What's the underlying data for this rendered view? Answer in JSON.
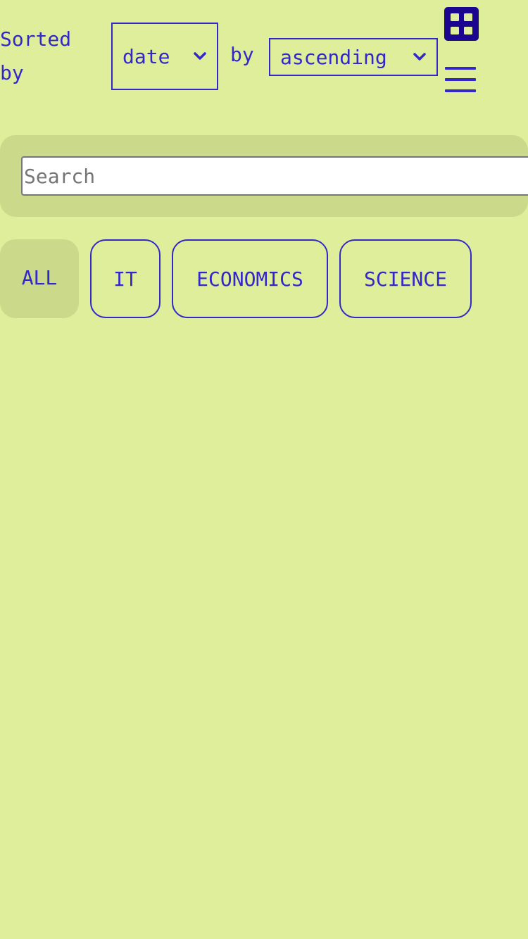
{
  "sort": {
    "prefix_label": "Sorted by",
    "field_selected": "date",
    "by_label": "by",
    "order_selected": "ascending"
  },
  "icons": {
    "grid": "grid-view-icon",
    "menu": "hamburger-menu-icon"
  },
  "search": {
    "placeholder": "Search",
    "value": ""
  },
  "filters": {
    "active": "ALL",
    "items": [
      {
        "label": "ALL"
      },
      {
        "label": "IT"
      },
      {
        "label": "ECONOMICS"
      },
      {
        "label": "SCIENCE"
      }
    ]
  },
  "colors": {
    "background": "#dfee9a",
    "panel": "#cad98a",
    "accent": "#3327c9",
    "icon_fill": "#1c0690"
  }
}
